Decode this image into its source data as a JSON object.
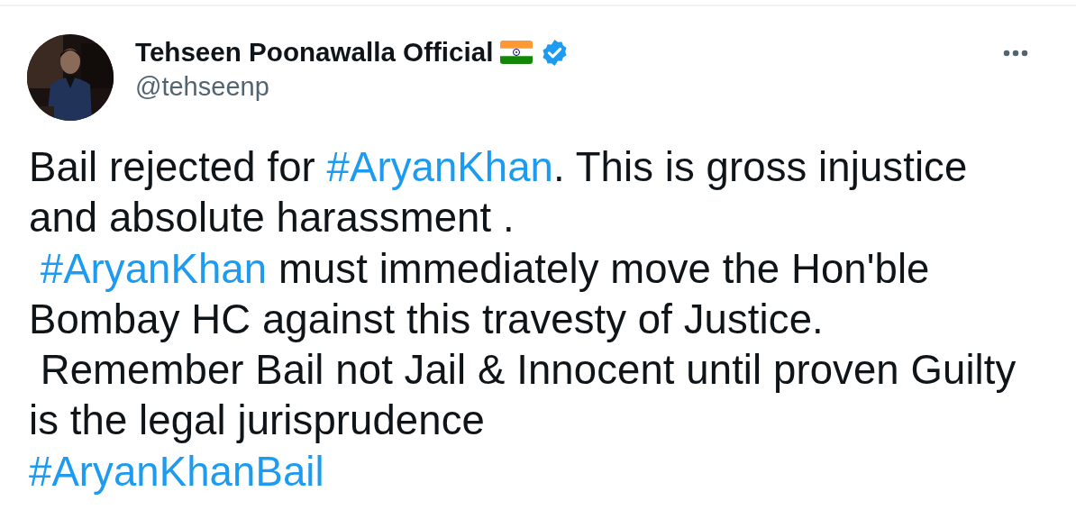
{
  "author": {
    "name": "Tehseen Poonawalla Official",
    "handle": "@tehseenp",
    "verified": true
  },
  "tweet_lines": [
    {
      "indent": false,
      "segments": [
        {
          "kind": "text",
          "text": "Bail rejected for "
        },
        {
          "kind": "hashtag",
          "text": "#AryanKhan"
        },
        {
          "kind": "text",
          "text": ". This is gross injustice"
        }
      ]
    },
    {
      "indent": false,
      "segments": [
        {
          "kind": "text",
          "text": "and absolute harassment ."
        }
      ]
    },
    {
      "indent": true,
      "segments": [
        {
          "kind": "hashtag",
          "text": "#AryanKhan"
        },
        {
          "kind": "text",
          "text": " must immediately move the Hon'ble"
        }
      ]
    },
    {
      "indent": false,
      "segments": [
        {
          "kind": "text",
          "text": "Bombay HC against this travesty of Justice."
        }
      ]
    },
    {
      "indent": true,
      "segments": [
        {
          "kind": "text",
          "text": "Remember Bail not Jail & Innocent until proven Guilty"
        }
      ]
    },
    {
      "indent": false,
      "segments": [
        {
          "kind": "text",
          "text": "is the legal jurisprudence"
        }
      ]
    },
    {
      "indent": false,
      "segments": [
        {
          "kind": "hashtag",
          "text": "#AryanKhanBail"
        }
      ]
    }
  ]
}
